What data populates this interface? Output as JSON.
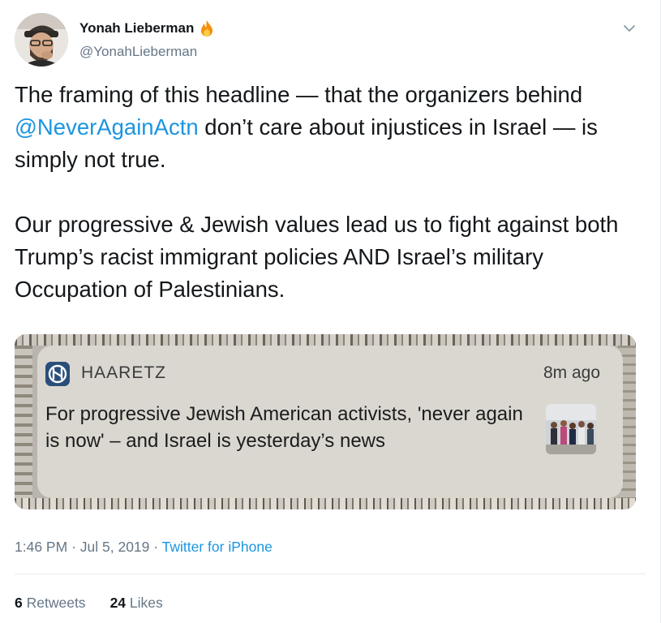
{
  "author": {
    "name": "Yonah Lieberman",
    "badge_icon": "fire-icon",
    "handle": "@YonahLieberman"
  },
  "tweet": {
    "line1_pre": "The framing of this headline — that the organizers behind ",
    "mention": "@NeverAgainActn",
    "line1_post": " don’t care about injustices in Israel — is simply not true.",
    "paragraph2": "Our progressive & Jewish values lead us to fight against both Trump’s racist immigrant policies AND Israel’s military Occupation of Palestinians."
  },
  "media": {
    "app_name": "HAARETZ",
    "time_ago": "8m ago",
    "headline": "For progressive Jewish American activists, 'never again is now' – and Israel is yesterday’s news"
  },
  "meta": {
    "time": "1:46 PM",
    "date": "Jul 5, 2019",
    "separator": "·",
    "source": "Twitter for iPhone"
  },
  "stats": {
    "retweets_count": "6",
    "retweets_label": "Retweets",
    "likes_count": "24",
    "likes_label": "Likes"
  },
  "colors": {
    "link": "#1b95e0",
    "secondary_text": "#657786",
    "primary_text": "#14171a"
  }
}
